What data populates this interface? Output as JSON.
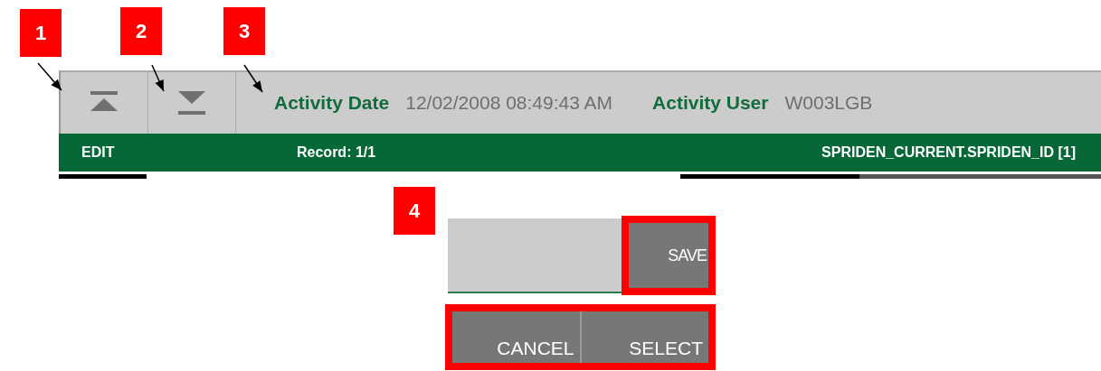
{
  "callouts": [
    {
      "label": "1"
    },
    {
      "label": "2"
    },
    {
      "label": "3"
    },
    {
      "label": "4"
    }
  ],
  "toolbar": {
    "buttons": [
      {
        "kind": "first"
      },
      {
        "kind": "last"
      }
    ],
    "fields": [
      {
        "label": "Activity Date",
        "value": "12/02/2008 08:49:43 AM"
      },
      {
        "label": "Activity User",
        "value": "W003LGB"
      }
    ]
  },
  "status_bar": {
    "mode": "EDIT",
    "record": "Record: 1/1",
    "field": "SPRIDEN_CURRENT.SPRIDEN_ID [1]"
  },
  "dialog": {
    "save": {
      "label": "SAVE",
      "highlighted": true
    },
    "buttons_highlighted": true,
    "buttons": [
      {
        "label": "CANCEL"
      },
      {
        "label": "SELECT"
      }
    ]
  }
}
